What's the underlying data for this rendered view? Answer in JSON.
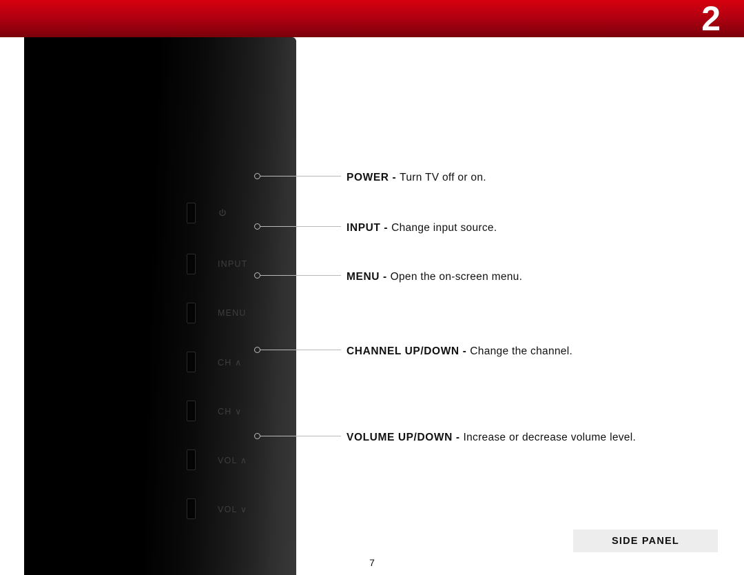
{
  "header": {
    "chapter_number": "2"
  },
  "panel": {
    "buttons": {
      "power_label": "",
      "input_label": "INPUT",
      "menu_label": "MENU",
      "ch_up_label": "CH ∧",
      "ch_down_label": "CH ∨",
      "vol_up_label": "VOL ∧",
      "vol_down_label": "VOL ∨"
    }
  },
  "descriptions": {
    "power": {
      "title": "POWER - ",
      "text": "Turn TV off or on."
    },
    "input": {
      "title": "INPUT - ",
      "text": "Change input source."
    },
    "menu": {
      "title": "MENU - ",
      "text": "Open the on-screen menu."
    },
    "channel": {
      "title": "CHANNEL UP/DOWN - ",
      "text": "Change the channel."
    },
    "volume": {
      "title": "VOLUME UP/DOWN - ",
      "text": "Increase or decrease volume level."
    }
  },
  "footer": {
    "tab_label": "SIDE PANEL",
    "page_number": "7"
  }
}
